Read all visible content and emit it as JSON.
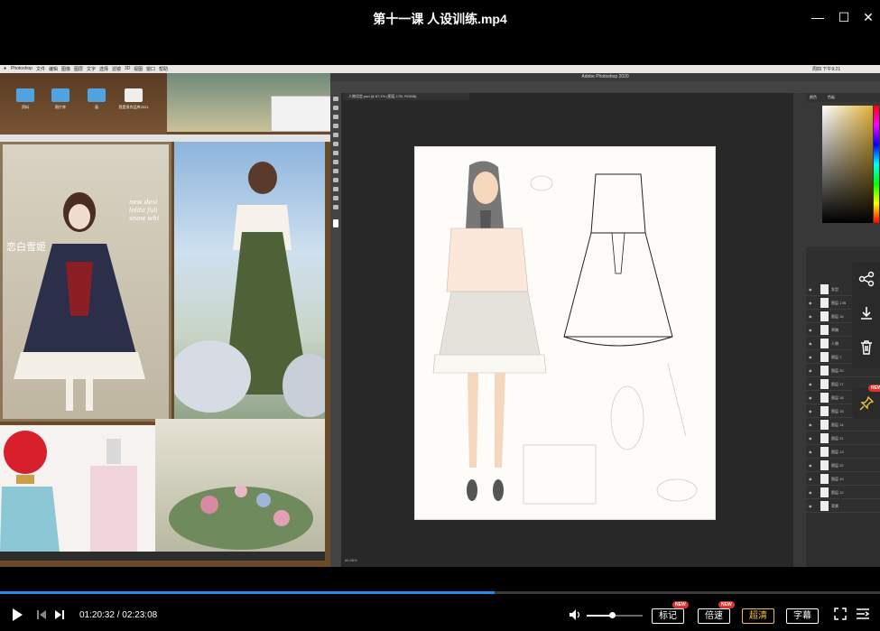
{
  "window": {
    "title": "第十一课 人设训练.mp4",
    "minimize_label": "—",
    "maximize_label": "☐",
    "close_label": "✕"
  },
  "video": {
    "mac_menu": [
      "Photoshop",
      "文件",
      "编辑",
      "图像",
      "图层",
      "文字",
      "选择",
      "滤镜",
      "3D",
      "视图",
      "窗口",
      "帮助"
    ],
    "mac_clock": "周四 下午9:21",
    "desktop_folders": [
      "资料",
      "照片库",
      "画",
      "我是男作品库2021"
    ],
    "photo_text_en": "new desi\nlolita fuli\nsnow whi",
    "photo_text_cn": "恋白雪姬",
    "ps_title": "Adobe Photoshop 2020",
    "ps_tab": "人物设定.psd @ 67.1% (图层 17B, RGB/8)",
    "ps_status": "66.98%",
    "panel_tabs": [
      "颜色",
      "色板"
    ],
    "layers": [
      "发型",
      "图层 17B",
      "图层 16",
      "草稿",
      "人物",
      "图层 7",
      "图层 20",
      "图层 17",
      "图层 18",
      "图层 15",
      "图层 14",
      "图层 21",
      "图层 13",
      "图层 22",
      "图层 19",
      "图层 12",
      "背景"
    ]
  },
  "float_bar": {
    "share_icon": "share-icon",
    "download_icon": "download-icon",
    "delete_icon": "trash-icon",
    "pin_badge": "NEW"
  },
  "player": {
    "progress": 0.5625,
    "time_current": "01:20:32",
    "time_total": "02:23:08",
    "time_display": "01:20:32 / 02:23:08",
    "volume": 0.45,
    "btn_notes": "标记",
    "btn_notes_badge": "NEW",
    "btn_speed": "倍速",
    "btn_speed_badge": "NEW",
    "btn_quality": "超清",
    "btn_subtitle": "字幕",
    "accent": "#1e8cf0",
    "quality_color": "#f0c040"
  }
}
